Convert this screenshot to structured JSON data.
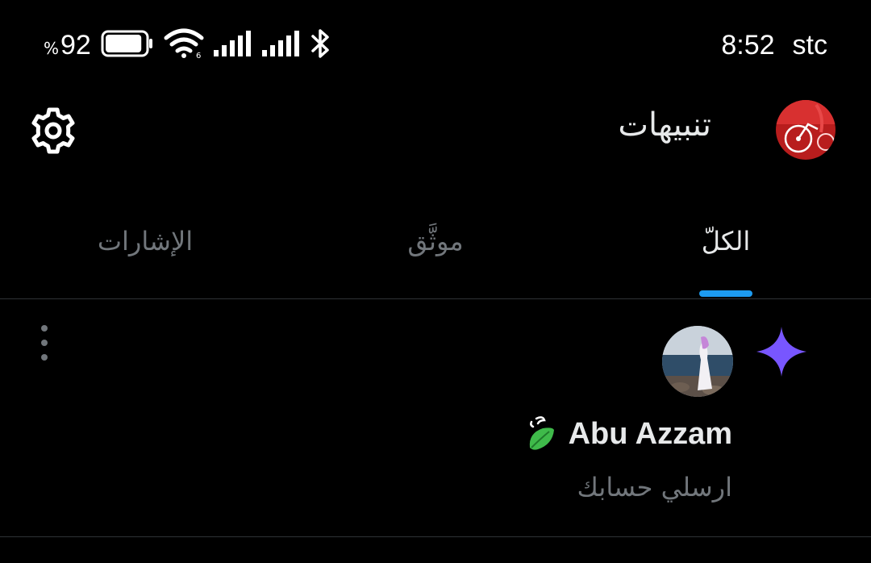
{
  "status_bar": {
    "battery_percent_sign": "%",
    "battery_percent": "92",
    "time": "8:52",
    "carrier": "stc",
    "battery_level": 0.92
  },
  "header": {
    "title": "تنبيهات"
  },
  "tabs": [
    {
      "label": "الكلّ",
      "active": true
    },
    {
      "label": "موثَّق",
      "active": false
    },
    {
      "label": "الإشارات",
      "active": false
    }
  ],
  "notification": {
    "user_name": "Abu Azzam",
    "text": "ارسلي حسابك"
  },
  "colors": {
    "accent": "#1d9bf0",
    "sparkle": "#7856ff",
    "leaf": "#3fba4a",
    "muted_text": "#71767b",
    "primary_text": "#e7e9ea"
  },
  "icons": [
    "battery-icon",
    "wifi-icon",
    "signal-icon",
    "bluetooth-icon",
    "gear-icon",
    "sparkle-icon",
    "leaf-icon",
    "more-vertical-icon"
  ]
}
